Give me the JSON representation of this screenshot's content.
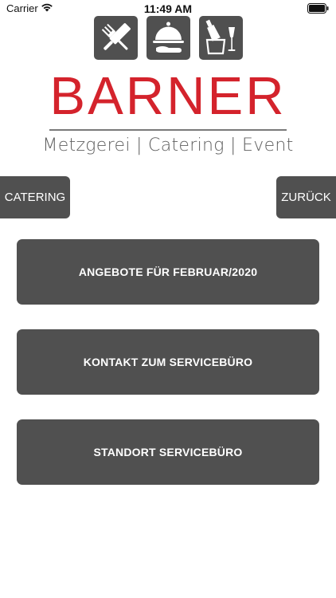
{
  "status_bar": {
    "carrier": "Carrier",
    "time": "11:49 AM",
    "wifi_icon": "wifi-icon",
    "battery_icon": "battery-icon"
  },
  "logo": {
    "icons": [
      "knife-fork-icon",
      "serving-cloche-icon",
      "champagne-bucket-icon"
    ],
    "brand": "BARNER",
    "tagline": "Metzgerei | Catering | Event",
    "colors": {
      "brand_red": "#d4232c",
      "tile_gray": "#505050"
    }
  },
  "nav": {
    "left_label": "CATERING",
    "right_label": "ZURÜCK"
  },
  "menu": {
    "items": [
      {
        "label": "ANGEBOTE FÜR FEBRUAR/2020"
      },
      {
        "label": "KONTAKT ZUM SERVICEBÜRO"
      },
      {
        "label": "STANDORT SERVICEBÜRO"
      }
    ]
  }
}
